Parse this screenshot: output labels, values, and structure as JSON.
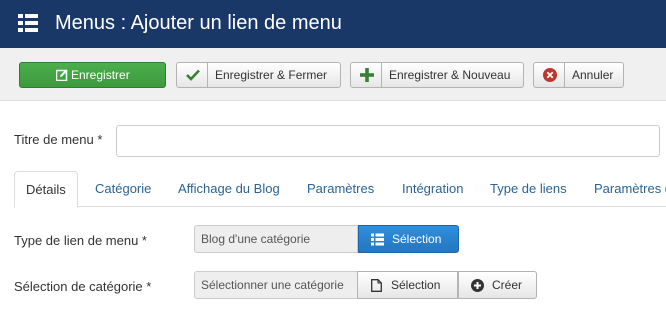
{
  "header": {
    "title": "Menus : Ajouter un lien de menu",
    "icon": "list-menu-icon"
  },
  "toolbar": {
    "save_label": "Enregistrer",
    "save_close_label": "Enregistrer & Fermer",
    "save_new_label": "Enregistrer & Nouveau",
    "cancel_label": "Annuler"
  },
  "form": {
    "title_label": "Titre de menu *",
    "title_value": ""
  },
  "tabs": [
    {
      "label": "Détails",
      "active": true
    },
    {
      "label": "Catégorie"
    },
    {
      "label": "Affichage du Blog"
    },
    {
      "label": "Paramètres"
    },
    {
      "label": "Intégration"
    },
    {
      "label": "Type de liens"
    },
    {
      "label": "Paramètres d"
    }
  ],
  "fields": {
    "link_type_label": "Type de lien de menu *",
    "link_type_value": "Blog d'une catégorie",
    "link_type_button": "Sélection",
    "category_label": "Sélection de catégorie *",
    "category_value": "Sélectionner une catégorie",
    "category_select_button": "Sélection",
    "category_create_button": "Créer"
  },
  "colors": {
    "header_bg": "#1a3867",
    "save_green": "#449d44",
    "select_blue": "#2a83d0",
    "cancel_red": "#bd362f",
    "add_green": "#378137"
  }
}
